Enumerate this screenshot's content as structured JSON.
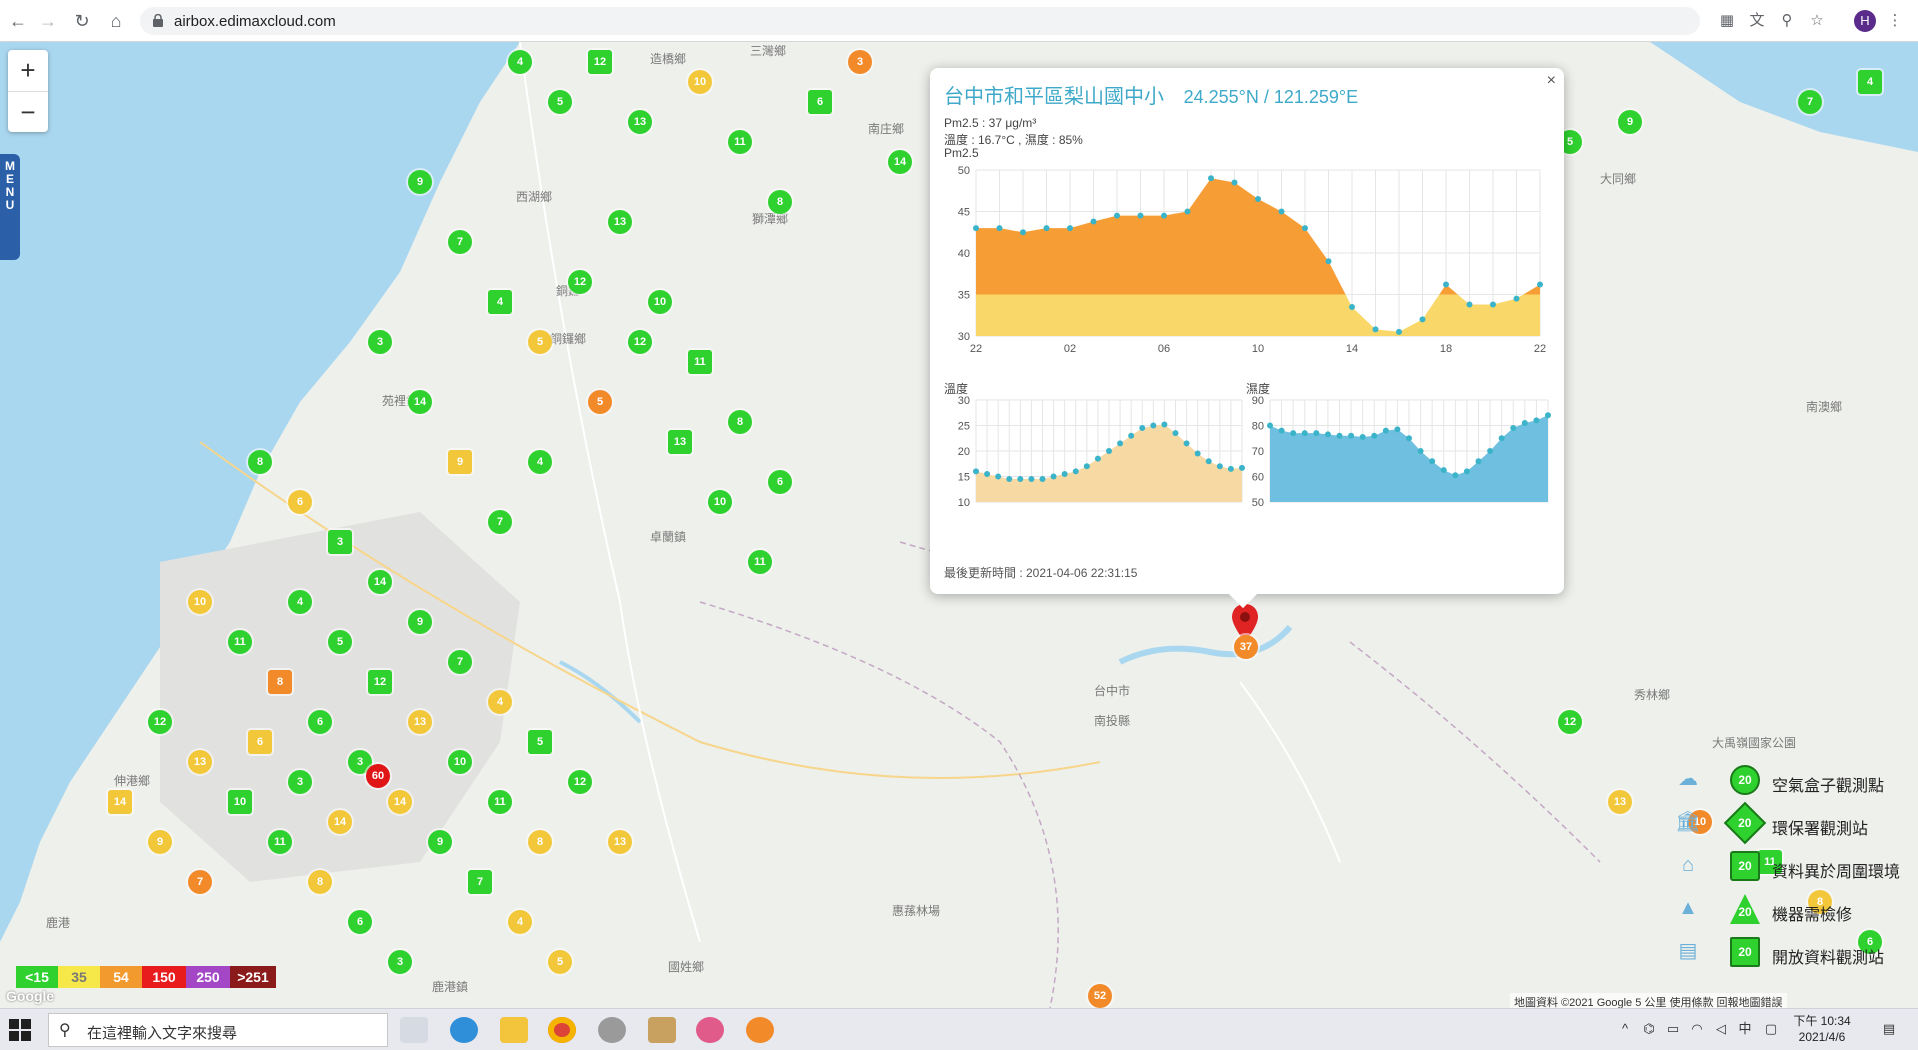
{
  "browser": {
    "url": "airbox.edimaxcloud.com",
    "profile_initial": "H",
    "icons": [
      "back-icon",
      "forward-icon",
      "reload-icon",
      "home-icon",
      "lock-icon",
      "qr-icon",
      "translate-icon",
      "zoom-icon",
      "star-icon",
      "more-icon"
    ]
  },
  "map": {
    "zoom_in_label": "+",
    "zoom_out_label": "−",
    "menu_label": "MENU",
    "place_labels": [
      "造橋鄉",
      "三灣鄉",
      "南庄鄉",
      "西湖鄉",
      "獅潭鄉",
      "銅鑼",
      "銅鑼鄉",
      "苑裡鎮",
      "卓蘭鎮",
      "台中市",
      "南投縣",
      "大同鄉",
      "秀林鄉",
      "南澳鄉",
      "伸港鄉",
      "鹿港",
      "惠蓀林場",
      "國姓鄉",
      "鹿港鎮",
      "大禹嶺國家公園",
      "南投縣"
    ],
    "markers_summary": "air quality readings",
    "highlight_marker_value": "37",
    "high_marker_value": "60",
    "far_marker_value": "52"
  },
  "popup": {
    "title": "台中市和平區梨山國中小",
    "coords": "24.255°N / 121.259°E",
    "close_label": "×",
    "pm25_line": "Pm2.5 : 37 μg/m³",
    "weather_line": "溫度 : 16.7°C , 濕度 : 85%",
    "chart_title": "Pm2.5",
    "temp_title": "溫度",
    "humidity_title": "濕度",
    "updated": "最後更新時間 : 2021-04-06 22:31:15"
  },
  "chart_data": [
    {
      "type": "area",
      "title": "Pm2.5",
      "x": [
        "22",
        "23",
        "00",
        "01",
        "02",
        "03",
        "04",
        "05",
        "06",
        "07",
        "08",
        "09",
        "10",
        "11",
        "12",
        "13",
        "14",
        "15",
        "16",
        "17",
        "18",
        "19",
        "20",
        "21",
        "22"
      ],
      "x_ticks": [
        "22",
        "02",
        "06",
        "10",
        "14",
        "18",
        "22"
      ],
      "y_ticks": [
        "30",
        "35",
        "40",
        "45",
        "50"
      ],
      "ylim": [
        30,
        50
      ],
      "values": [
        43,
        43,
        42.5,
        43,
        43,
        43.8,
        44.5,
        44.5,
        44.5,
        45,
        49,
        48.5,
        46.5,
        45,
        43,
        39,
        33.5,
        30.8,
        30.5,
        32,
        36.2,
        33.8,
        33.8,
        34.5,
        36.2
      ],
      "thresholds": [
        {
          "value": 35,
          "color": "#f9d768"
        },
        {
          "value": 50,
          "color": "#f79d35"
        }
      ]
    },
    {
      "type": "area",
      "title": "溫度",
      "y_ticks": [
        "10",
        "15",
        "20",
        "25",
        "30"
      ],
      "ylim": [
        10,
        30
      ],
      "values": [
        16,
        15.5,
        15,
        14.5,
        14.5,
        14.5,
        14.5,
        15,
        15.5,
        16,
        17,
        18.5,
        20,
        21.5,
        23,
        24.5,
        25,
        25.2,
        23.5,
        21.5,
        19.5,
        18,
        17,
        16.5,
        16.7
      ]
    },
    {
      "type": "area",
      "title": "濕度",
      "y_ticks": [
        "50",
        "60",
        "70",
        "80",
        "90"
      ],
      "ylim": [
        50,
        90
      ],
      "values": [
        80,
        78,
        77,
        77,
        77,
        76.5,
        76,
        76,
        75.5,
        76,
        78,
        78.5,
        75,
        70,
        66,
        62.5,
        60.5,
        62,
        66,
        70,
        75,
        79,
        81,
        82,
        84
      ]
    }
  ],
  "legend": {
    "items": [
      {
        "label": "空氣盒子觀測點",
        "value": "20",
        "icon": "airbox-icon"
      },
      {
        "label": "環保署觀測站",
        "value": "20",
        "icon": "epa-station-icon"
      },
      {
        "label": "資料異於周圍環境",
        "value": "20",
        "icon": "anomaly-icon"
      },
      {
        "label": "機器需檢修",
        "value": "20",
        "icon": "repair-cone-icon"
      },
      {
        "label": "開放資料觀測站",
        "value": "20",
        "icon": "open-data-icon"
      }
    ]
  },
  "aqi_scale": {
    "segments": [
      {
        "label": "<15",
        "color": "#2ed12e"
      },
      {
        "label": "35",
        "color": "#f7e84a"
      },
      {
        "label": "54",
        "color": "#f29a2e"
      },
      {
        "label": "150",
        "color": "#e81c1c"
      },
      {
        "label": "250",
        "color": "#a347c7"
      },
      {
        "label": ">251",
        "color": "#8b1a1a"
      }
    ]
  },
  "map_footer": {
    "google": "Google",
    "attribution": "地圖資料 ©2021 Google   5 公里        使用條款   回報地圖錯誤"
  },
  "taskbar": {
    "search_placeholder": "在這裡輸入文字來搜尋",
    "time": "下午 10:34",
    "date": "2021/4/6",
    "ime": "中"
  }
}
